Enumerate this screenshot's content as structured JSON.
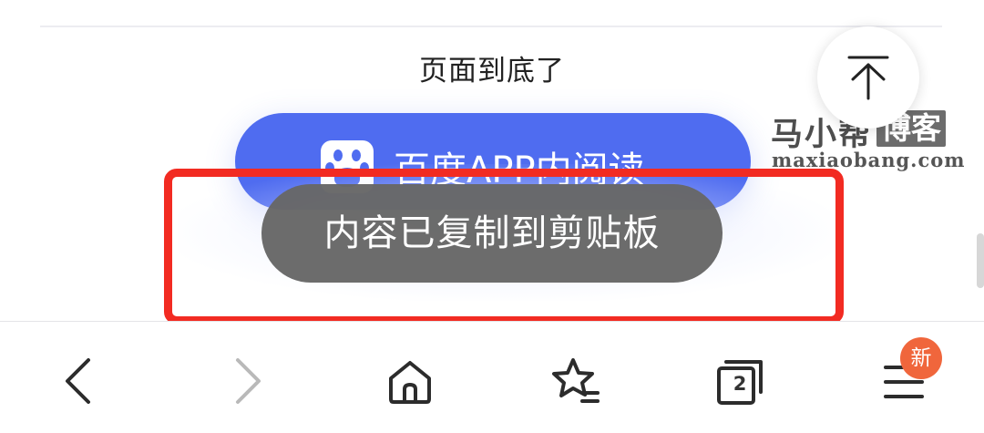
{
  "page": {
    "end_message": "页面到底了"
  },
  "read_in_app": {
    "label": "百度APP内阅读",
    "icon": "baidu-paw-icon",
    "color": "#4f6cf0"
  },
  "toast": {
    "message": "内容已复制到剪贴板",
    "color": "#676767"
  },
  "watermark": {
    "name": "马小帮",
    "badge": "博客",
    "url": "maxiaobang.com"
  },
  "back_to_top": {
    "icon": "arrow-up-to-top-icon"
  },
  "highlight": {
    "color": "#f22b22"
  },
  "toolbar": {
    "back_icon": "chevron-left-icon",
    "forward_icon": "chevron-right-icon",
    "home_icon": "home-icon",
    "favorites_icon": "star-list-icon",
    "tabs_icon": "tabs-icon",
    "tab_count": "2",
    "menu_icon": "menu-icon",
    "new_badge": "新",
    "badge_color": "#f0663c"
  }
}
